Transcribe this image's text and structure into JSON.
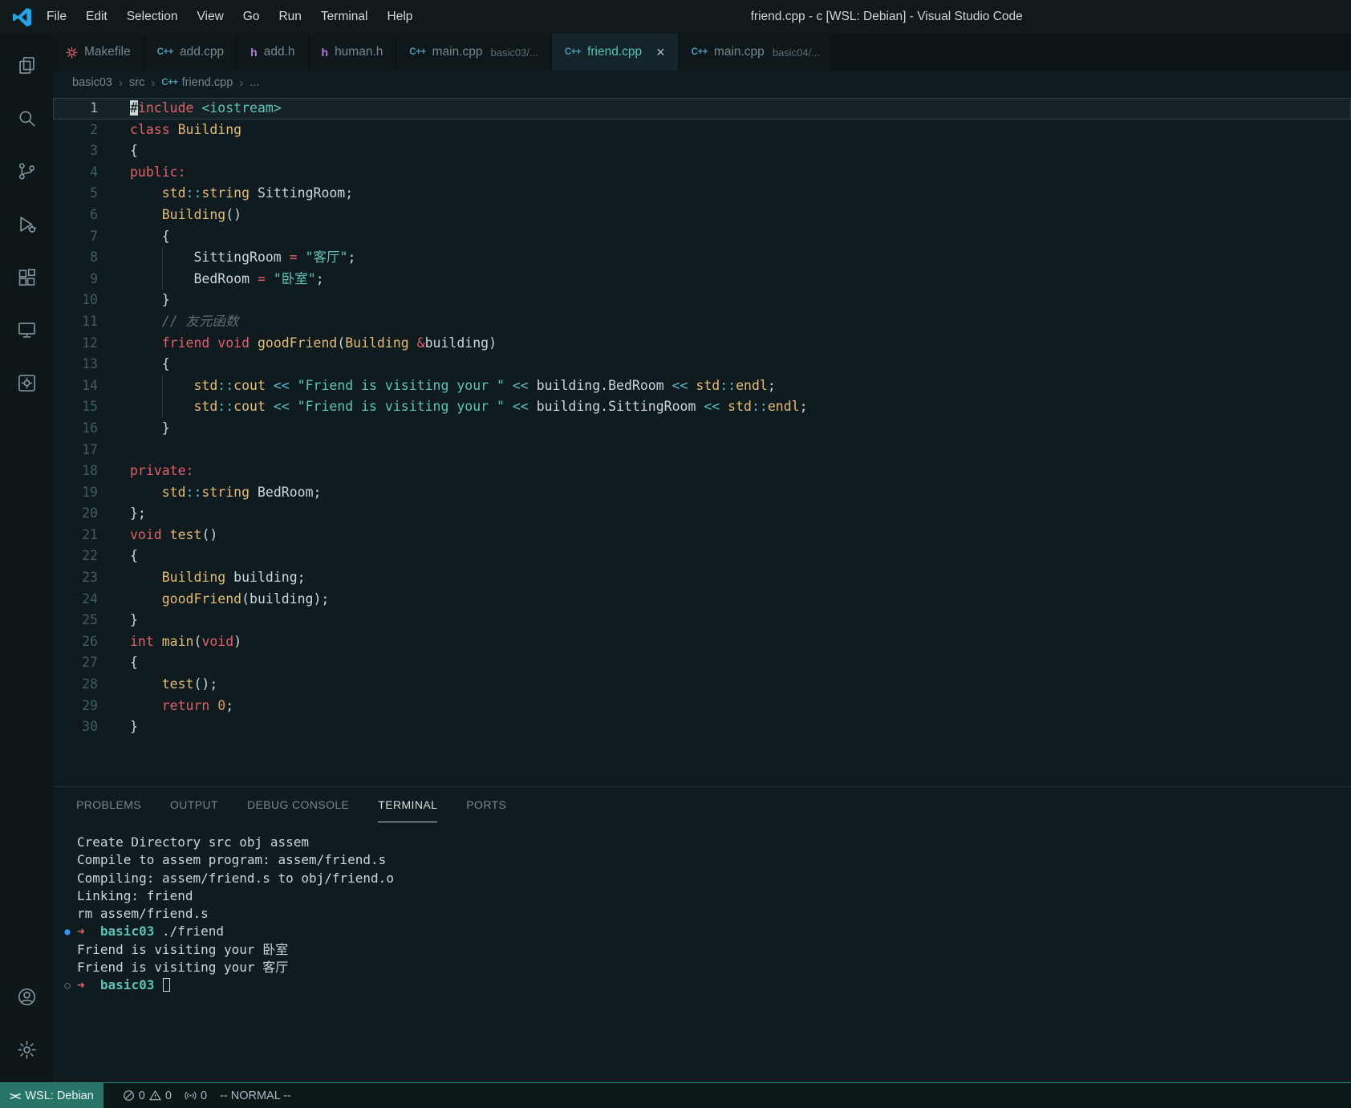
{
  "title_bar": {
    "title": "friend.cpp - c [WSL: Debian] - Visual Studio Code",
    "menus": [
      "File",
      "Edit",
      "Selection",
      "View",
      "Go",
      "Run",
      "Terminal",
      "Help"
    ]
  },
  "activity_bar": {
    "top": [
      "explorer-icon",
      "search-icon",
      "source-control-icon",
      "run-and-debug-icon",
      "extensions-icon",
      "remote-explorer-icon",
      "makefile-tools-icon"
    ],
    "bottom": [
      "accounts-icon",
      "settings-gear-icon"
    ]
  },
  "tab_bar": {
    "tabs": [
      {
        "label": "Makefile",
        "icon": "makefile"
      },
      {
        "label": "add.cpp",
        "icon": "cpp"
      },
      {
        "label": "add.h",
        "icon": "h"
      },
      {
        "label": "human.h",
        "icon": "h"
      },
      {
        "label": "main.cpp",
        "detail": "basic03/...",
        "icon": "cpp"
      },
      {
        "label": "friend.cpp",
        "icon": "cpp",
        "active": true,
        "close_label": "×"
      },
      {
        "label": "main.cpp",
        "detail": "basic04/...",
        "icon": "cpp"
      }
    ]
  },
  "breadcrumb": {
    "separator": "›",
    "items": [
      {
        "label": "basic03"
      },
      {
        "label": "src"
      },
      {
        "label": "friend.cpp",
        "icon": "cpp"
      },
      {
        "label": "..."
      }
    ]
  },
  "editor": {
    "language": "cpp",
    "lines": [
      {
        "n": 1,
        "indent": 0,
        "current": true,
        "tokens": [
          [
            "#",
            "k cur"
          ],
          [
            "include",
            "k"
          ],
          [
            " ",
            "p"
          ],
          [
            "<iostream>",
            "s"
          ]
        ]
      },
      {
        "n": 2,
        "indent": 0,
        "tokens": [
          [
            "class",
            "k"
          ],
          [
            " ",
            "p"
          ],
          [
            "Building",
            "t"
          ]
        ]
      },
      {
        "n": 3,
        "indent": 0,
        "tokens": [
          [
            "{",
            "p"
          ]
        ]
      },
      {
        "n": 4,
        "indent": 0,
        "tokens": [
          [
            "public:",
            "k"
          ]
        ]
      },
      {
        "n": 5,
        "indent": 4,
        "tokens": [
          [
            "std",
            "t"
          ],
          [
            "::",
            "o"
          ],
          [
            "string",
            "t"
          ],
          [
            " ",
            "p"
          ],
          [
            "SittingRoom",
            "p"
          ],
          [
            ";",
            "p"
          ]
        ]
      },
      {
        "n": 6,
        "indent": 4,
        "tokens": [
          [
            "Building",
            "t"
          ],
          [
            "()",
            "p"
          ]
        ]
      },
      {
        "n": 7,
        "indent": 4,
        "tokens": [
          [
            "{",
            "p"
          ]
        ]
      },
      {
        "n": 8,
        "indent": 8,
        "tokens": [
          [
            "SittingRoom",
            "p"
          ],
          [
            " ",
            "p"
          ],
          [
            "=",
            "k"
          ],
          [
            " ",
            "p"
          ],
          [
            "\"客厅\"",
            "s"
          ],
          [
            ";",
            "p"
          ]
        ]
      },
      {
        "n": 9,
        "indent": 8,
        "tokens": [
          [
            "BedRoom",
            "p"
          ],
          [
            " ",
            "p"
          ],
          [
            "=",
            "k"
          ],
          [
            " ",
            "p"
          ],
          [
            "\"卧室\"",
            "s"
          ],
          [
            ";",
            "p"
          ]
        ]
      },
      {
        "n": 10,
        "indent": 4,
        "tokens": [
          [
            "}",
            "p"
          ]
        ]
      },
      {
        "n": 11,
        "indent": 4,
        "tokens": [
          [
            "// 友元函数",
            "c"
          ]
        ]
      },
      {
        "n": 12,
        "indent": 4,
        "tokens": [
          [
            "friend",
            "k"
          ],
          [
            " ",
            "p"
          ],
          [
            "void",
            "k"
          ],
          [
            " ",
            "p"
          ],
          [
            "goodFriend",
            "t"
          ],
          [
            "(",
            "p"
          ],
          [
            "Building",
            "t"
          ],
          [
            " ",
            "p"
          ],
          [
            "&",
            "k"
          ],
          [
            "building",
            "p"
          ],
          [
            ")",
            "p"
          ]
        ]
      },
      {
        "n": 13,
        "indent": 4,
        "tokens": [
          [
            "{",
            "p"
          ]
        ]
      },
      {
        "n": 14,
        "indent": 8,
        "tokens": [
          [
            "std",
            "t"
          ],
          [
            "::",
            "o"
          ],
          [
            "cout",
            "t"
          ],
          [
            " ",
            "p"
          ],
          [
            "<<",
            "o"
          ],
          [
            " ",
            "p"
          ],
          [
            "\"Friend is visiting your \"",
            "s"
          ],
          [
            " ",
            "p"
          ],
          [
            "<<",
            "o"
          ],
          [
            " ",
            "p"
          ],
          [
            "building",
            "p"
          ],
          [
            ".",
            "p"
          ],
          [
            "BedRoom",
            "p"
          ],
          [
            " ",
            "p"
          ],
          [
            "<<",
            "o"
          ],
          [
            " ",
            "p"
          ],
          [
            "std",
            "t"
          ],
          [
            "::",
            "o"
          ],
          [
            "endl",
            "t"
          ],
          [
            ";",
            "p"
          ]
        ]
      },
      {
        "n": 15,
        "indent": 8,
        "tokens": [
          [
            "std",
            "t"
          ],
          [
            "::",
            "o"
          ],
          [
            "cout",
            "t"
          ],
          [
            " ",
            "p"
          ],
          [
            "<<",
            "o"
          ],
          [
            " ",
            "p"
          ],
          [
            "\"Friend is visiting your \"",
            "s"
          ],
          [
            " ",
            "p"
          ],
          [
            "<<",
            "o"
          ],
          [
            " ",
            "p"
          ],
          [
            "building",
            "p"
          ],
          [
            ".",
            "p"
          ],
          [
            "SittingRoom",
            "p"
          ],
          [
            " ",
            "p"
          ],
          [
            "<<",
            "o"
          ],
          [
            " ",
            "p"
          ],
          [
            "std",
            "t"
          ],
          [
            "::",
            "o"
          ],
          [
            "endl",
            "t"
          ],
          [
            ";",
            "p"
          ]
        ]
      },
      {
        "n": 16,
        "indent": 4,
        "tokens": [
          [
            "}",
            "p"
          ]
        ]
      },
      {
        "n": 17,
        "indent": 0,
        "tokens": []
      },
      {
        "n": 18,
        "indent": 0,
        "tokens": [
          [
            "private:",
            "k"
          ]
        ]
      },
      {
        "n": 19,
        "indent": 4,
        "tokens": [
          [
            "std",
            "t"
          ],
          [
            "::",
            "o"
          ],
          [
            "string",
            "t"
          ],
          [
            " ",
            "p"
          ],
          [
            "BedRoom",
            "p"
          ],
          [
            ";",
            "p"
          ]
        ]
      },
      {
        "n": 20,
        "indent": 0,
        "tokens": [
          [
            "};",
            "p"
          ]
        ]
      },
      {
        "n": 21,
        "indent": 0,
        "tokens": [
          [
            "void",
            "k"
          ],
          [
            " ",
            "p"
          ],
          [
            "test",
            "t"
          ],
          [
            "()",
            "p"
          ]
        ]
      },
      {
        "n": 22,
        "indent": 0,
        "tokens": [
          [
            "{",
            "p"
          ]
        ]
      },
      {
        "n": 23,
        "indent": 4,
        "tokens": [
          [
            "Building",
            "t"
          ],
          [
            " ",
            "p"
          ],
          [
            "building",
            "p"
          ],
          [
            ";",
            "p"
          ]
        ]
      },
      {
        "n": 24,
        "indent": 4,
        "tokens": [
          [
            "goodFriend",
            "t"
          ],
          [
            "(",
            "p"
          ],
          [
            "building",
            "p"
          ],
          [
            ");",
            "p"
          ]
        ]
      },
      {
        "n": 25,
        "indent": 0,
        "tokens": [
          [
            "}",
            "p"
          ]
        ]
      },
      {
        "n": 26,
        "indent": 0,
        "tokens": [
          [
            "int",
            "k"
          ],
          [
            " ",
            "p"
          ],
          [
            "main",
            "t"
          ],
          [
            "(",
            "p"
          ],
          [
            "void",
            "k"
          ],
          [
            ")",
            "p"
          ]
        ]
      },
      {
        "n": 27,
        "indent": 0,
        "tokens": [
          [
            "{",
            "p"
          ]
        ]
      },
      {
        "n": 28,
        "indent": 4,
        "tokens": [
          [
            "test",
            "t"
          ],
          [
            "();",
            "p"
          ]
        ]
      },
      {
        "n": 29,
        "indent": 4,
        "tokens": [
          [
            "return",
            "k"
          ],
          [
            " ",
            "p"
          ],
          [
            "0",
            "n"
          ],
          [
            ";",
            "p"
          ]
        ]
      },
      {
        "n": 30,
        "indent": 0,
        "tokens": [
          [
            "}",
            "p"
          ]
        ]
      }
    ]
  },
  "panel": {
    "tabs": [
      {
        "label": "PROBLEMS"
      },
      {
        "label": "OUTPUT"
      },
      {
        "label": "DEBUG CONSOLE"
      },
      {
        "label": "TERMINAL",
        "active": true
      },
      {
        "label": "PORTS"
      }
    ]
  },
  "terminal": {
    "lines": [
      {
        "tokens": [
          [
            "Create Directory src obj assem",
            "p"
          ]
        ]
      },
      {
        "tokens": [
          [
            "Compile to assem program: assem/friend.s",
            "p"
          ]
        ]
      },
      {
        "tokens": [
          [
            "Compiling: assem/friend.s to obj/friend.o",
            "p"
          ]
        ]
      },
      {
        "tokens": [
          [
            "Linking: friend",
            "p"
          ]
        ]
      },
      {
        "tokens": [
          [
            "rm assem/friend.s",
            "p"
          ]
        ]
      },
      {
        "deco": "blue-dot",
        "tokens": [
          [
            "➜",
            "arrow"
          ],
          [
            "  ",
            "p"
          ],
          [
            "basic03",
            "dir"
          ],
          [
            " ./friend",
            "p"
          ]
        ]
      },
      {
        "tokens": [
          [
            "Friend is visiting your 卧室",
            "p"
          ]
        ]
      },
      {
        "tokens": [
          [
            "Friend is visiting your 客厅",
            "p"
          ]
        ]
      },
      {
        "deco": "circle",
        "cursor": true,
        "tokens": [
          [
            "➜",
            "arrow"
          ],
          [
            "  ",
            "p"
          ],
          [
            "basic03",
            "dir"
          ],
          [
            " ",
            "p"
          ]
        ]
      }
    ]
  },
  "status_bar": {
    "remote_label": "WSL: Debian",
    "error_count": "0",
    "warning_count": "0",
    "port_count": "0",
    "mode_text": "-- NORMAL --"
  },
  "colors": {
    "accent_teal": "#2c8a7c",
    "remote_bg": "#287567",
    "keyword": "#e0606c",
    "type_function": "#e3bb7b",
    "string": "#5ec4b6",
    "operator": "#5ac0cc",
    "comment": "#5b6f73",
    "number": "#d79a66",
    "plain_text": "#ccd6d8",
    "terminal_prompt_arrow": "#e0646a",
    "terminal_dir": "#57c2b5",
    "file_icon_cpp": "#519aba",
    "file_icon_header": "#b180d7",
    "file_icon_makefile": "#e0606c",
    "command_decoration_blue": "#3794ff"
  }
}
